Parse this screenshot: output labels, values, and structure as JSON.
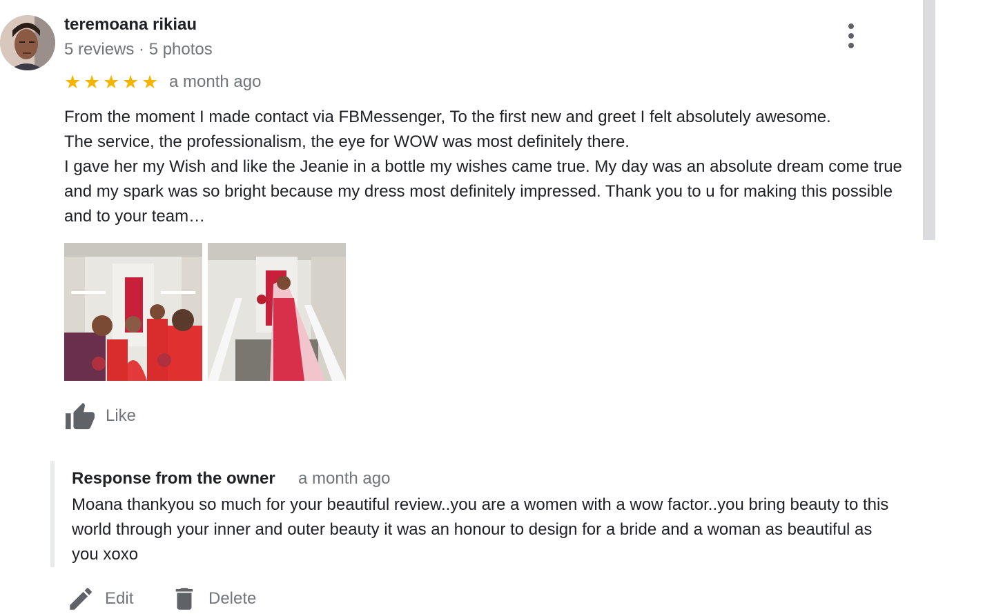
{
  "review": {
    "reviewer_name": "teremoana rikiau",
    "reviewer_meta": "5 reviews · 5 photos",
    "rating": 5,
    "rating_stars": [
      "★",
      "★",
      "★",
      "★",
      "★"
    ],
    "date": "a month ago",
    "text": "From the moment I made contact via FBMessenger, To the first new and greet I felt absolutely awesome.\nThe service, the professionalism, the eye for WOW was most definitely there.\nI gave her my Wish and like the Jeanie in a bottle my wishes came true. My day was an absolute dream come true and my spark was so bright because my dress most definitely impressed. Thank you to u for making this possible and to your team…",
    "photos": [
      "bridal-party-photo",
      "bride-on-steps-photo"
    ],
    "star_color": "#f4b400"
  },
  "actions": {
    "like_label": "Like",
    "edit_label": "Edit",
    "delete_label": "Delete"
  },
  "owner_response": {
    "title": "Response from the owner",
    "date": "a month ago",
    "text": "Moana thankyou so much for your beautiful review..you are a women with a wow factor..you bring beauty to this world through your inner and outer beauty it was an honour to design for a bride and a woman as beautiful as you xoxo"
  },
  "icons": {
    "more": "more-vert-icon",
    "like": "thumb-up-icon",
    "edit": "pencil-icon",
    "delete": "trash-icon"
  }
}
